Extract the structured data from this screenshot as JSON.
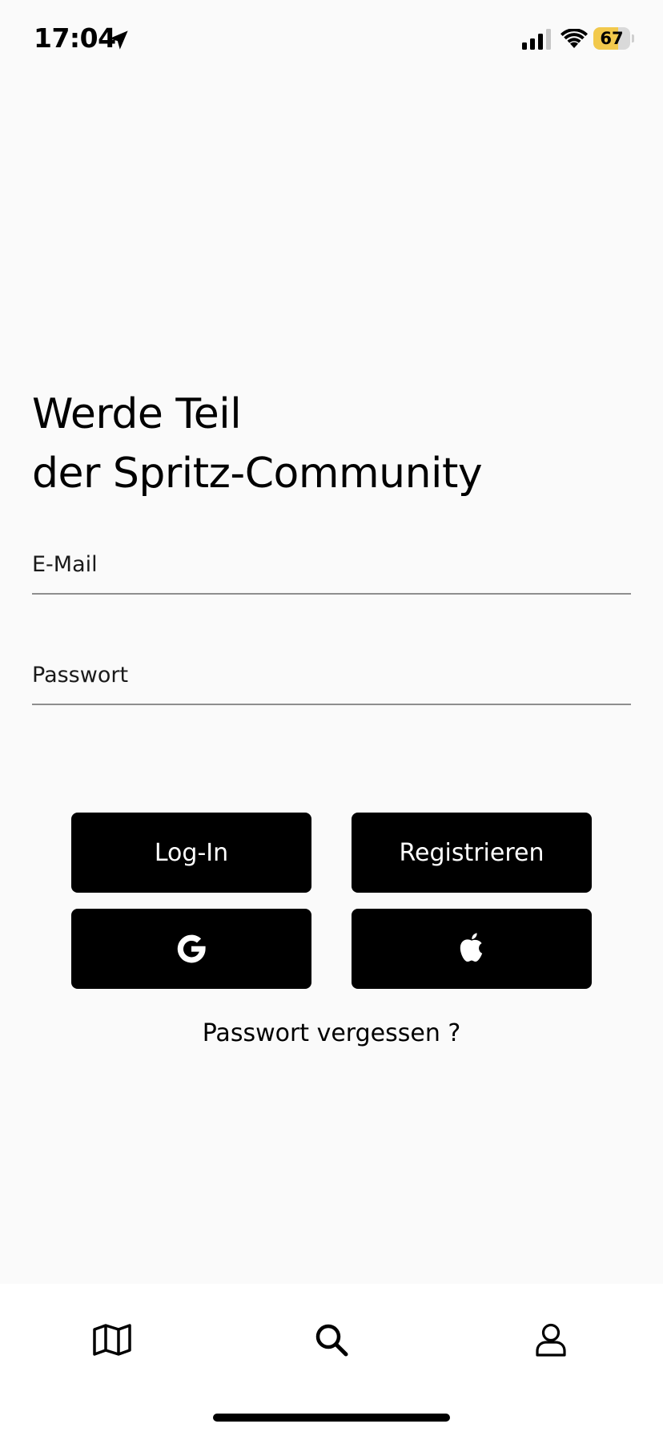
{
  "status_bar": {
    "time": "17:04",
    "battery_level": "67",
    "battery_fraction": 0.67,
    "icons": [
      "location-arrow-icon",
      "cellular-signal-icon",
      "wifi-icon",
      "battery-icon"
    ]
  },
  "headline": {
    "line1": "Werde Teil",
    "line2": "der Spritz-Community"
  },
  "form": {
    "email": {
      "value": "",
      "placeholder": "E-Mail"
    },
    "password": {
      "value": "",
      "placeholder": "Passwort"
    }
  },
  "buttons": {
    "login_label": "Log-In",
    "register_label": "Registrieren",
    "google_icon": "google-icon",
    "apple_icon": "apple-icon"
  },
  "forgot_password_label": "Passwort vergessen ?",
  "tab_bar": {
    "items": [
      {
        "icon": "map-icon"
      },
      {
        "icon": "search-icon"
      },
      {
        "icon": "profile-icon"
      }
    ]
  },
  "colors": {
    "background": "#fafafa",
    "button": "#000000",
    "button_text": "#ffffff",
    "battery_fill": "#f2c94c",
    "tab_bar": "#ffffff"
  }
}
